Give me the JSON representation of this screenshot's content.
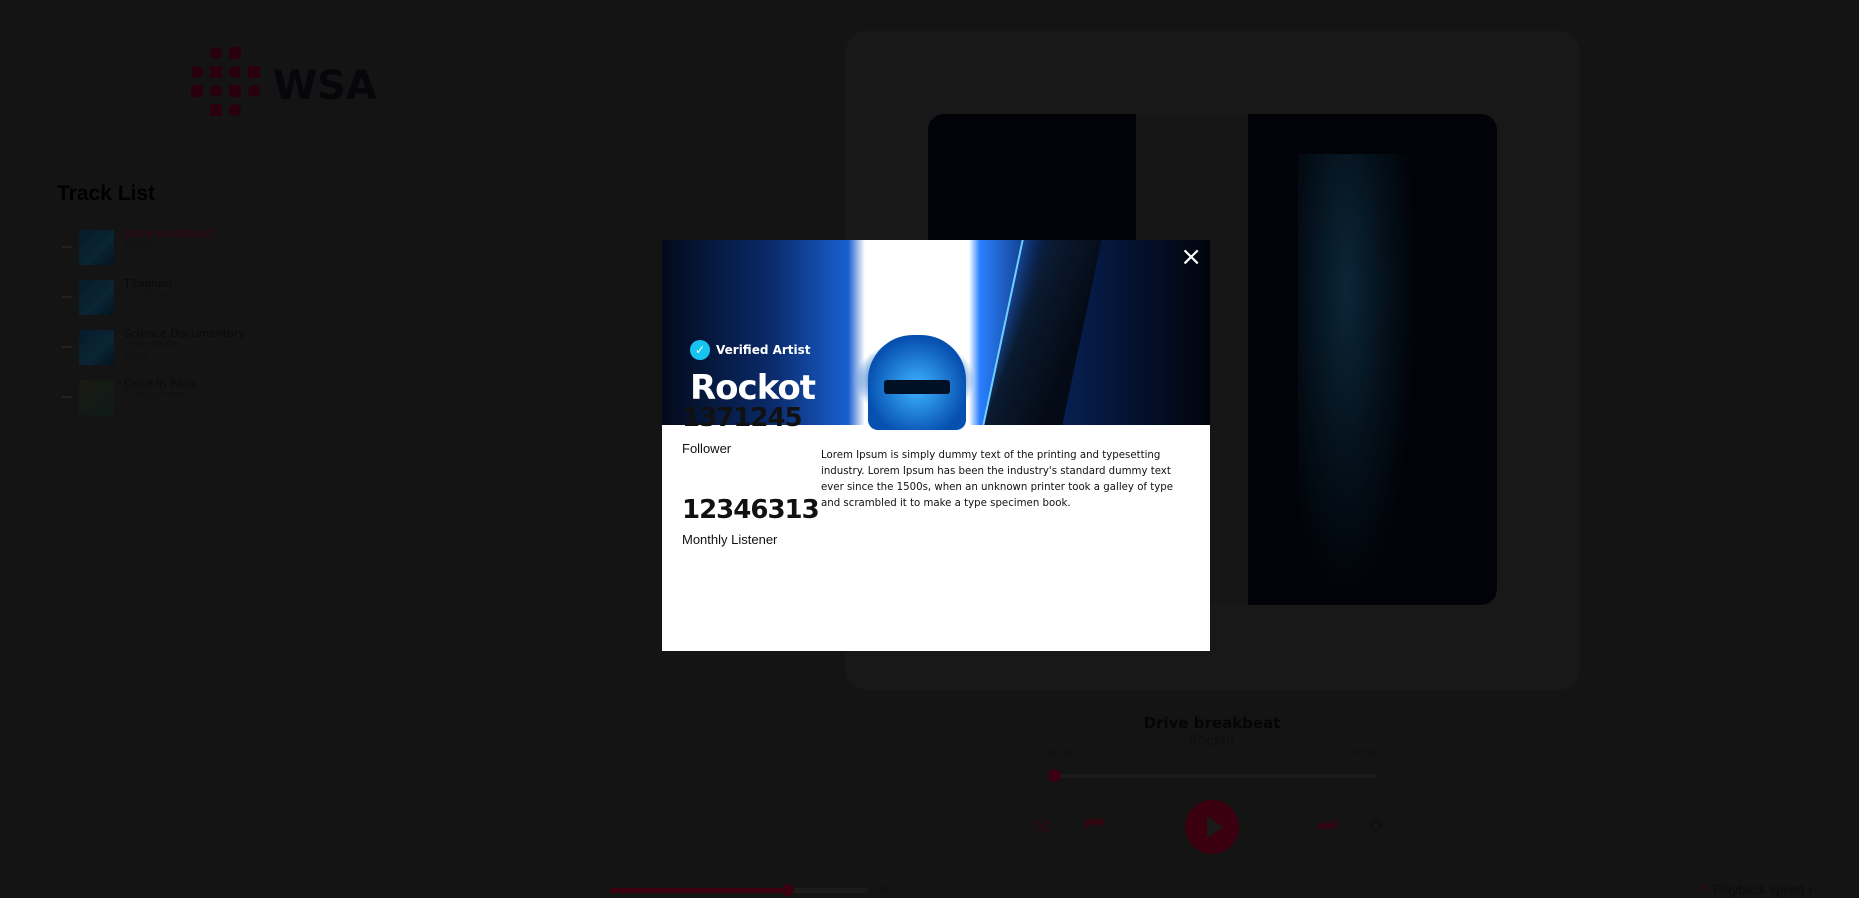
{
  "logo": {
    "text": "WSA"
  },
  "track_list": {
    "title": "Track List",
    "items": [
      {
        "title": "Drive breakbeat",
        "artist": "Rockot",
        "year": "2023",
        "active": true
      },
      {
        "title": "Titanium",
        "artist": "AlisiaBeats",
        "year": "2023"
      },
      {
        "title": "Science Documentory",
        "artist": "Lexin_Music",
        "year": "2023"
      },
      {
        "title": "Once In Paris",
        "artist": "Pumpupthemind",
        "year": "2023"
      }
    ]
  },
  "modal": {
    "verified_label": "Verified Artist",
    "artist_name": "Rockot",
    "close_icon": "×",
    "bio": "Lorem Ipsum is simply dummy text of the printing and typesetting industry. Lorem Ipsum has been the industry's standard dummy text ever since the 1500s, when an unknown printer took a galley of type and scrambled it to make a type specimen book.",
    "followers": "1371245",
    "followers_label": "Follower",
    "monthly_listeners": "12346313",
    "monthly_listeners_label": "Monthly Listener"
  },
  "player": {
    "title": "Drive breakbeat",
    "artist": "Rockot",
    "current_time": "00:00",
    "duration": "00:00",
    "progress": 0,
    "volume": 0.69,
    "playback_speed_label": "Playback speed",
    "accent": "#e0003a"
  }
}
